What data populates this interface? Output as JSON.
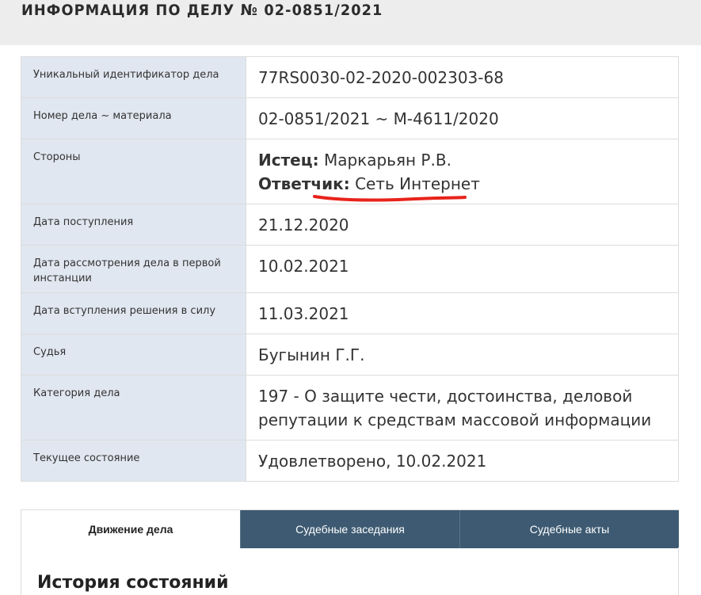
{
  "header": {
    "title": "ИНФОРМАЦИЯ ПО ДЕЛУ № 02-0851/2021"
  },
  "case_info": {
    "rows": [
      {
        "label": "Уникальный идентификатор дела",
        "value": "77RS0030-02-2020-002303-68"
      },
      {
        "label": "Номер дела ~ материала",
        "value": "02-0851/2021 ~ М-4611/2020"
      },
      {
        "label": "Стороны",
        "parties": [
          {
            "role": "Истец:",
            "name": "Маркарьян Р.В."
          },
          {
            "role": "Ответчик:",
            "name": "Сеть Интернет"
          }
        ]
      },
      {
        "label": "Дата поступления",
        "value": "21.12.2020"
      },
      {
        "label": "Дата рассмотрения дела в первой инстанции",
        "value": "10.02.2021"
      },
      {
        "label": "Дата вступления решения в силу",
        "value": "11.03.2021"
      },
      {
        "label": "Судья",
        "value": "Бугынин Г.Г."
      },
      {
        "label": "Категория дела",
        "value": "197 - О защите чести, достоинства, деловой репутации к средствам массовой информации"
      },
      {
        "label": "Текущее состояние",
        "value": "Удовлетворено, 10.02.2021"
      }
    ]
  },
  "annotation": {
    "color": "#e8231b"
  },
  "tabs": [
    {
      "label": "Движение дела",
      "active": true
    },
    {
      "label": "Судебные заседания",
      "active": false
    },
    {
      "label": "Судебные акты",
      "active": false
    }
  ],
  "panel": {
    "heading": "История состояний"
  },
  "colors": {
    "header_bg": "#ededed",
    "label_bg": "#e1e7f0",
    "tab_inactive_bg": "#3d5a72"
  }
}
